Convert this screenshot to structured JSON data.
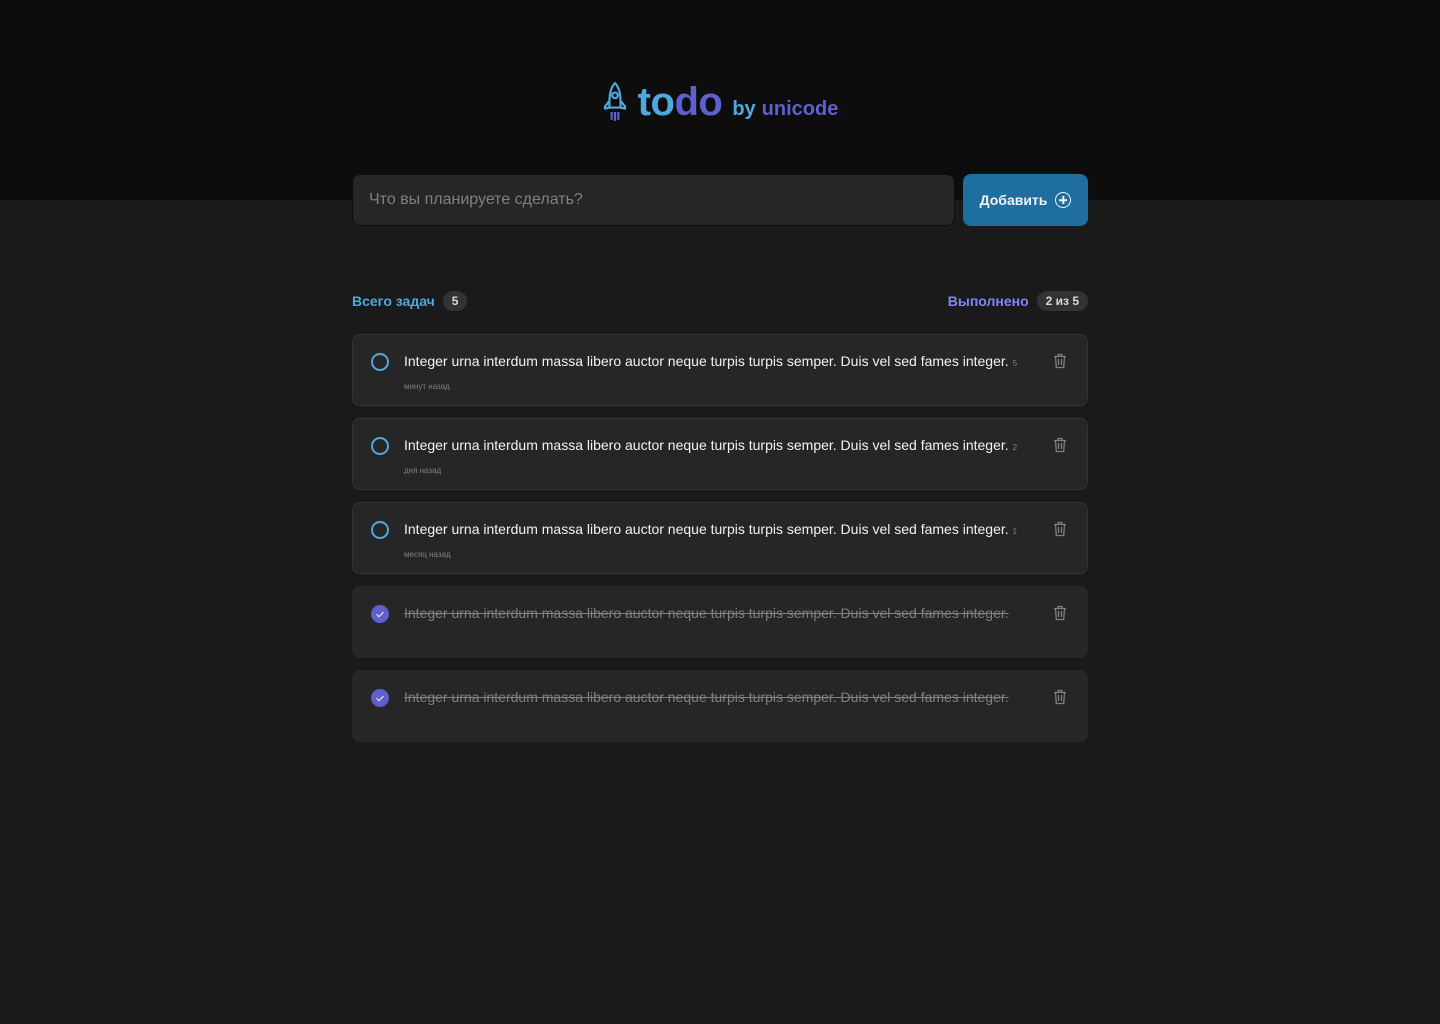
{
  "brand": {
    "todo_part1": "to",
    "todo_part2": "do",
    "by": "by",
    "unicode": "unicode",
    "icon": "rocket-icon"
  },
  "add": {
    "placeholder": "Что вы планируете сделать?",
    "button_label": "Добавить",
    "button_icon": "plus-circle-icon"
  },
  "stats": {
    "total_label": "Всего задач",
    "total_count": "5",
    "done_label": "Выполнено",
    "done_count": "2 из 5"
  },
  "tasks": [
    {
      "text": "Integer urna interdum massa libero auctor neque turpis turpis semper. Duis vel sed fames integer.",
      "time": "5 минут назад",
      "done": false
    },
    {
      "text": "Integer urna interdum massa libero auctor neque turpis turpis semper. Duis vel sed fames integer.",
      "time": "2 дня назад",
      "done": false
    },
    {
      "text": "Integer urna interdum massa libero auctor neque turpis turpis semper. Duis vel sed fames integer.",
      "time": "1 месяц назад",
      "done": false
    },
    {
      "text": "Integer urna interdum massa libero auctor neque turpis turpis semper. Duis vel sed fames integer.",
      "time": "",
      "done": true
    },
    {
      "text": "Integer urna interdum massa libero auctor neque turpis turpis semper. Duis vel sed fames integer.",
      "time": "",
      "done": true
    }
  ],
  "colors": {
    "blue": "#4ea8de",
    "blue_dark": "#1e6f9f",
    "purple": "#5e60ce",
    "purple_light": "#8284fa"
  }
}
